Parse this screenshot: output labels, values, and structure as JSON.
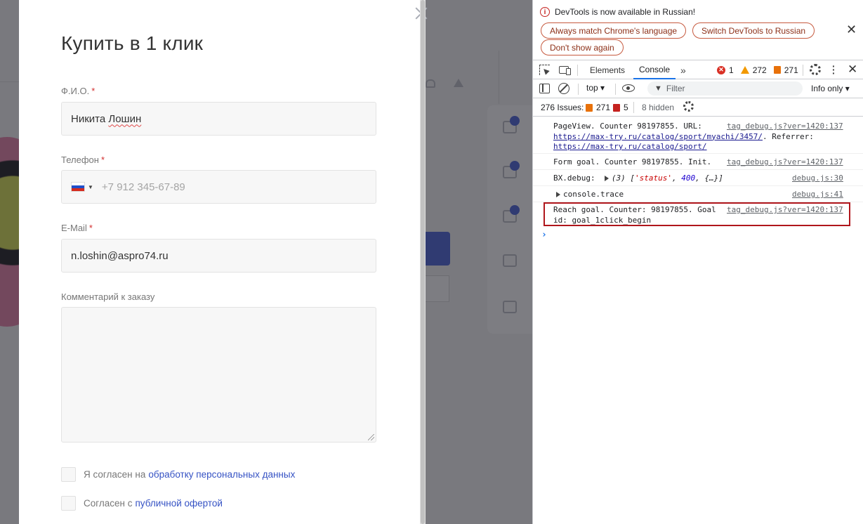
{
  "modal": {
    "title": "Купить в 1 клик",
    "fields": {
      "name": {
        "label": "Ф.И.О.",
        "required": "*",
        "value_before": "Никита ",
        "value_typo": "Лошин"
      },
      "phone": {
        "label": "Телефон",
        "required": "*",
        "placeholder": "+7 912 345-67-89",
        "flag": "ru-flag-icon"
      },
      "email": {
        "label": "E-Mail",
        "required": "*",
        "value": "n.loshin@aspro74.ru"
      },
      "comment": {
        "label": "Комментарий к заказу",
        "value": ""
      }
    },
    "consents": [
      {
        "text": "Я согласен на",
        "link": "обработку персональных данных",
        "checked": false
      },
      {
        "text": "Согласен с",
        "link": "публичной офертой",
        "checked": false
      }
    ]
  },
  "devtools": {
    "infobar": {
      "message": "DevTools is now available in Russian!",
      "buttons": [
        "Always match Chrome's language",
        "Switch DevTools to Russian",
        "Don't show again"
      ]
    },
    "tabs": {
      "elements": "Elements",
      "console": "Console",
      "active": "Console"
    },
    "counts": {
      "errors": "1",
      "warnings": "272",
      "issues": "271"
    },
    "toolbar": {
      "context": "top ▾",
      "filter_placeholder": "Filter",
      "levels": "Info only ▾"
    },
    "issues_bar": {
      "label": "276 Issues:",
      "info_count": "271",
      "other_count": "5",
      "hidden": "8 hidden"
    },
    "messages": [
      {
        "text_1": "PageView. Counter 98197855. URL:",
        "link_1": "https://max-try.ru/catalog/sport/myachi/3457/",
        "text_2": ". Referrer:",
        "link_2": "https://max-try.ru/catalog/sport/",
        "source": "tag_debug.js?ver=1420:137"
      },
      {
        "text": "Form goal. Counter 98197855. Init.",
        "source": "tag_debug.js?ver=1420:137"
      },
      {
        "prefix": "BX.debug:",
        "count": "(3)",
        "str": "'status'",
        "num": "400",
        "rest": "{…}",
        "source": "debug.js:30"
      },
      {
        "text": "console.trace",
        "source": "debug.js:41"
      },
      {
        "text_1": "Reach goal. Counter: 98197855. Goal",
        "text_2": "id: goal_1click_begin",
        "source": "tag_debug.js?ver=1420:137",
        "highlighted": true
      }
    ],
    "prompt": "›"
  },
  "colors": {
    "accent": "#3552c4",
    "required": "#d32f2f",
    "devtools_tab_active": "#1a73e8",
    "highlight_border": "#b0161c"
  }
}
